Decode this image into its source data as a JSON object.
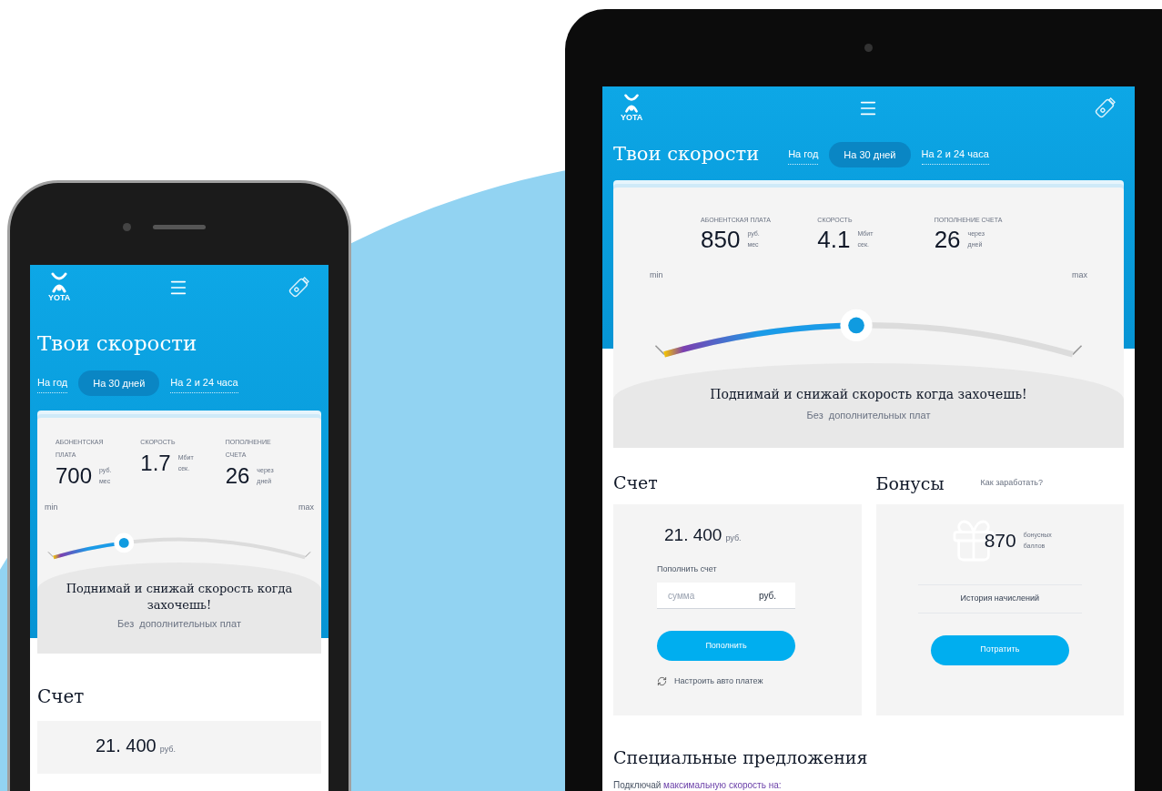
{
  "devices": [
    {
      "kind": "phone",
      "logo": "YOTA",
      "title": "Твои скорости",
      "tabs": [
        {
          "label": "На год",
          "selected": false
        },
        {
          "label": "На 30 дней",
          "selected": true
        },
        {
          "label": "На 2 и 24 часа",
          "selected": false
        }
      ],
      "stats": [
        {
          "label": "АБОНЕНТСКАЯ ПЛАТА",
          "value": "700",
          "unit_top": "руб.",
          "unit_bottom": "мес"
        },
        {
          "label": "СКОРОСТЬ",
          "value": "1.7",
          "unit_top": "Мбит",
          "unit_bottom": "сек."
        },
        {
          "label": "ПОПОЛНЕНИЕ СЧЕТА",
          "value": "26",
          "unit_top": "через",
          "unit_bottom": "дней"
        }
      ],
      "slider": {
        "min_label": "min",
        "max_label": "max",
        "level": 0.28
      },
      "headline": "Поднимай и снижай скорость когда захочешь!",
      "subline": "Без  дополнительных плат",
      "account": {
        "heading": "Счет",
        "balance": "21. 400",
        "unit": "руб."
      }
    },
    {
      "kind": "tablet",
      "logo": "YOTA",
      "title": "Твои скорости",
      "tabs": [
        {
          "label": "На год",
          "selected": false
        },
        {
          "label": "На 30 дней",
          "selected": true
        },
        {
          "label": "На 2 и 24 часа",
          "selected": false
        }
      ],
      "stats": [
        {
          "label": "АБОНЕНТСКАЯ ПЛАТА",
          "value": "850",
          "unit_top": "руб.",
          "unit_bottom": "мес"
        },
        {
          "label": "СКОРОСТЬ",
          "value": "4.1",
          "unit_top": "Мбит",
          "unit_bottom": "сек."
        },
        {
          "label": "ПОПОЛНЕНИЕ СЧЕТА",
          "value": "26",
          "unit_top": "через",
          "unit_bottom": "дней"
        }
      ],
      "slider": {
        "min_label": "min",
        "max_label": "max",
        "level": 0.47
      },
      "headline": "Поднимай и снижай скорость когда захочешь!",
      "subline": "Без  дополнительных плат",
      "account": {
        "heading": "Счет",
        "balance": "21. 400",
        "unit": "руб.",
        "topup_label": "Пополнить счет",
        "amount_placeholder": "сумма",
        "amount_unit": "руб.",
        "button": "Пополнить",
        "autopay": "Настроить авто платеж"
      },
      "bonuses": {
        "heading": "Бонусы",
        "link": "Как заработать?",
        "points": "870",
        "unit_top": "бонусных",
        "unit_bottom": "баллов",
        "history": "История начислений",
        "button": "Потратить"
      },
      "offers": {
        "heading": "Специальные предложения",
        "text": "Подключай",
        "link": "максимальную скорость на:"
      }
    }
  ]
}
